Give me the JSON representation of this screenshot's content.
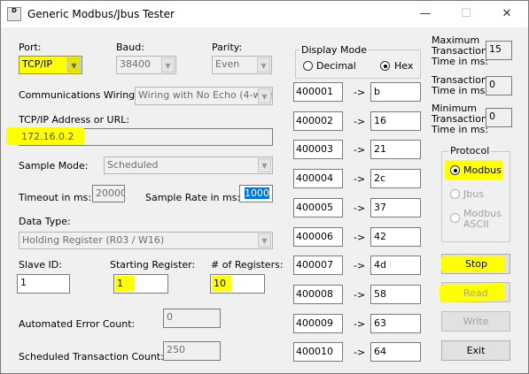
{
  "window": {
    "title": "Generic Modbus/Jbus Tester",
    "icon_text": "D",
    "minimize": "—",
    "maximize": "☐",
    "close": "✕"
  },
  "port": {
    "label": "Port:",
    "value": "TCP/IP"
  },
  "baud": {
    "label": "Baud:",
    "value": "38400"
  },
  "parity": {
    "label": "Parity:",
    "value": "Even"
  },
  "wiring": {
    "label": "Communications Wiring:",
    "value": "Wiring with No Echo (4-wire)"
  },
  "address": {
    "label": "TCP/IP Address or URL:",
    "value": "172.16.0.2"
  },
  "sample_mode": {
    "label": "Sample Mode:",
    "value": "Scheduled"
  },
  "timeout": {
    "label": "Timeout in ms:",
    "value": "20000"
  },
  "sample_rate": {
    "label": "Sample Rate in ms:",
    "value": "1000"
  },
  "data_type": {
    "label": "Data Type:",
    "value": "Holding Register (R03 / W16)"
  },
  "slave_id": {
    "label": "Slave ID:",
    "value": "1"
  },
  "starting_register": {
    "label": "Starting Register:",
    "value": "1"
  },
  "num_registers": {
    "label": "# of Registers:",
    "value": "10"
  },
  "error_count": {
    "label": "Automated Error Count:",
    "value": "0"
  },
  "scheduled_count": {
    "label": "Scheduled Transaction Count:",
    "value": "250"
  },
  "display_mode": {
    "title": "Display Mode",
    "options": [
      "Decimal",
      "Hex"
    ],
    "selected": "Hex"
  },
  "registers": [
    {
      "address": "400001",
      "arrow": "->",
      "value": "b"
    },
    {
      "address": "400002",
      "arrow": "->",
      "value": "16"
    },
    {
      "address": "400003",
      "arrow": "->",
      "value": "21"
    },
    {
      "address": "400004",
      "arrow": "->",
      "value": "2c"
    },
    {
      "address": "400005",
      "arrow": "->",
      "value": "37"
    },
    {
      "address": "400006",
      "arrow": "->",
      "value": "42"
    },
    {
      "address": "400007",
      "arrow": "->",
      "value": "4d"
    },
    {
      "address": "400008",
      "arrow": "->",
      "value": "58"
    },
    {
      "address": "400009",
      "arrow": "->",
      "value": "63"
    },
    {
      "address": "400010",
      "arrow": "->",
      "value": "64"
    }
  ],
  "stats": {
    "max": {
      "l1": "Maximum",
      "l2": "Transaction",
      "l3": "Time in ms:",
      "value": "15"
    },
    "last": {
      "l1": "Transaction",
      "l2": "Time in ms:",
      "value": "0"
    },
    "min": {
      "l1": "Minimum",
      "l2": "Transaction",
      "l3": "Time in ms:",
      "value": "0"
    }
  },
  "protocol": {
    "title": "Protocol",
    "modbus": "Modbus",
    "jbus": "Jbus",
    "ascii_l1": "Modbus",
    "ascii_l2": "ASCII",
    "selected": "Modbus"
  },
  "buttons": {
    "stop": "Stop",
    "read": "Read",
    "write": "Write",
    "exit": "Exit"
  },
  "colors": {
    "highlight": "#ffff00",
    "selection": "#0078d7"
  }
}
